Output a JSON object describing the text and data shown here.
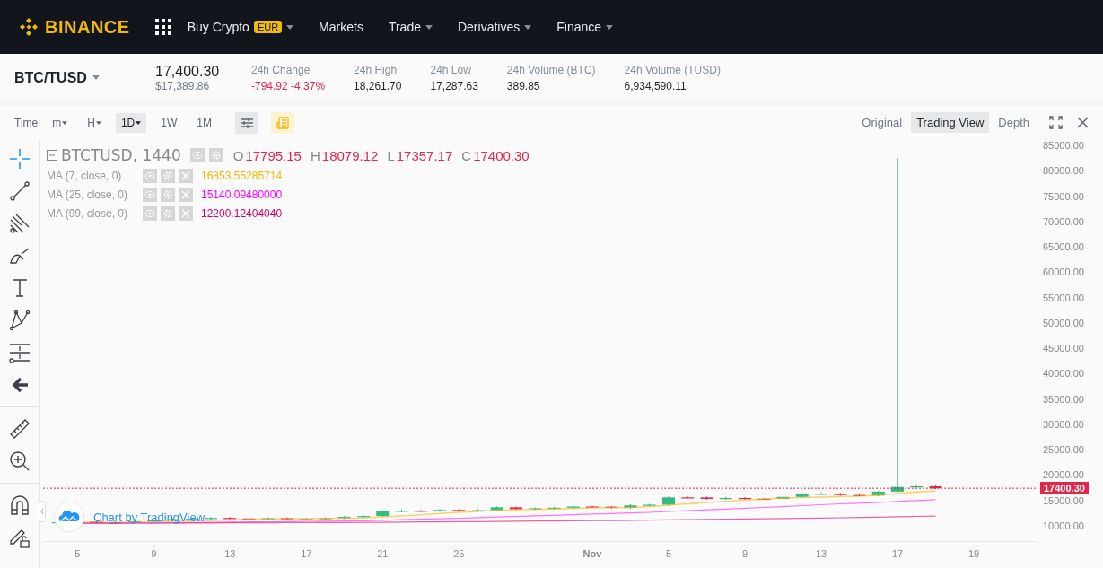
{
  "header": {
    "logo": "BINANCE",
    "nav": [
      {
        "label": "Buy Crypto",
        "badge": "EUR",
        "has_menu": true
      },
      {
        "label": "Markets",
        "has_menu": false
      },
      {
        "label": "Trade",
        "has_menu": true
      },
      {
        "label": "Derivatives",
        "has_menu": true
      },
      {
        "label": "Finance",
        "has_menu": true
      }
    ]
  },
  "ticker": {
    "pair": "BTC/TUSD",
    "price": "17,400.30",
    "price_usd": "$17,389.86",
    "stats": [
      {
        "label": "24h Change",
        "value": "-794.92 -4.37%",
        "kind": "down"
      },
      {
        "label": "24h High",
        "value": "18,261.70",
        "kind": "plain"
      },
      {
        "label": "24h Low",
        "value": "17,287.63",
        "kind": "plain"
      },
      {
        "label": "24h Volume (BTC)",
        "value": "389.85",
        "kind": "plain"
      },
      {
        "label": "24h Volume (TUSD)",
        "value": "6,934,590.11",
        "kind": "plain"
      }
    ]
  },
  "toolbar": {
    "time_label": "Time",
    "intervals": [
      {
        "label": "m",
        "has_menu": true,
        "selected": false
      },
      {
        "label": "H",
        "has_menu": true,
        "selected": false
      },
      {
        "label": "1D",
        "has_menu": true,
        "selected": true
      },
      {
        "label": "1W",
        "has_menu": false,
        "selected": false
      },
      {
        "label": "1M",
        "has_menu": false,
        "selected": false
      }
    ],
    "views": [
      {
        "label": "Original",
        "selected": false
      },
      {
        "label": "Trading View",
        "selected": true
      },
      {
        "label": "Depth",
        "selected": false
      }
    ]
  },
  "legend": {
    "symbol": "BTCTUSD, 1440",
    "ohlc": [
      {
        "letter": "O",
        "value": "17795.15"
      },
      {
        "letter": "H",
        "value": "18079.12"
      },
      {
        "letter": "L",
        "value": "17357.17"
      },
      {
        "letter": "C",
        "value": "17400.30"
      }
    ],
    "indicators": [
      {
        "name": "MA (7, close, 0)",
        "value": "16853.55285714",
        "color": "#f5b700"
      },
      {
        "name": "MA (25, close, 0)",
        "value": "15140.09480000",
        "color": "#ff00ff"
      },
      {
        "name": "MA (99, close, 0)",
        "value": "12200.12404040",
        "color": "#d6006b"
      }
    ]
  },
  "chart": {
    "y_ticks": [
      "85000.00",
      "80000.00",
      "75000.00",
      "70000.00",
      "65000.00",
      "60000.00",
      "55000.00",
      "50000.00",
      "45000.00",
      "40000.00",
      "35000.00",
      "30000.00",
      "25000.00",
      "20000.00",
      "15000.00",
      "10000.00"
    ],
    "x_labels": [
      {
        "label": "5",
        "bold": false
      },
      {
        "label": "9",
        "bold": false
      },
      {
        "label": "13",
        "bold": false
      },
      {
        "label": "17",
        "bold": false
      },
      {
        "label": "21",
        "bold": false
      },
      {
        "label": "25",
        "bold": false
      },
      {
        "label": "Nov",
        "bold": true
      },
      {
        "label": "5",
        "bold": false
      },
      {
        "label": "9",
        "bold": false
      },
      {
        "label": "13",
        "bold": false
      },
      {
        "label": "17",
        "bold": false
      },
      {
        "label": "19",
        "bold": false
      }
    ],
    "last_price": "17400.30",
    "attribution": "Chart by TradingView"
  }
}
